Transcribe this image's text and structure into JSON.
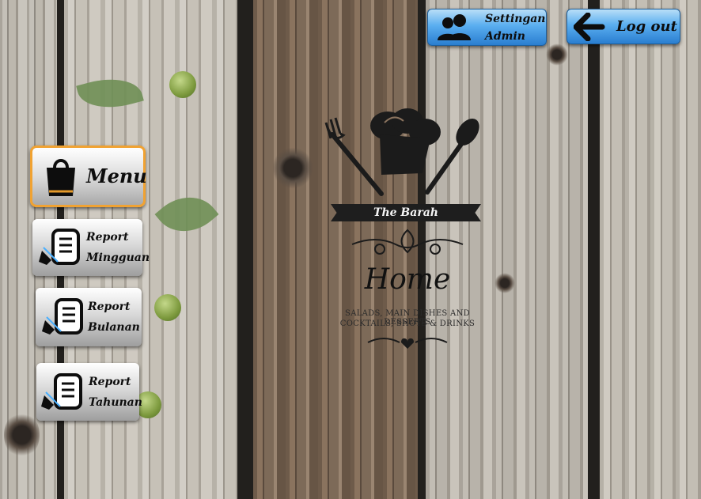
{
  "header": {
    "settings_button": {
      "line1": "Settingan",
      "line2": "Admin",
      "icon": "users-icon"
    },
    "logout_button": {
      "label": "Log out",
      "icon": "arrow-left-icon"
    }
  },
  "sidebar": {
    "menu_button": {
      "label": "Menu",
      "icon": "shopping-bag-icon"
    },
    "report_weekly": {
      "line1": "Report",
      "line2": "Mingguan",
      "icon": "report-document-icon"
    },
    "report_monthly": {
      "line1": "Report",
      "line2": "Bulanan",
      "icon": "report-document-icon"
    },
    "report_yearly": {
      "line1": "Report",
      "line2": "Tahunan",
      "icon": "report-document-icon"
    }
  },
  "logo": {
    "brand": "The Barah",
    "title": "Home",
    "tagline1": "SALADS, MAIN DISHES AND DESSERTS",
    "tagline2": "COCKTAILS, SHOTS & DRINKS"
  },
  "colors": {
    "blue_button": "#4a9fe8",
    "menu_border": "#f0a232"
  }
}
